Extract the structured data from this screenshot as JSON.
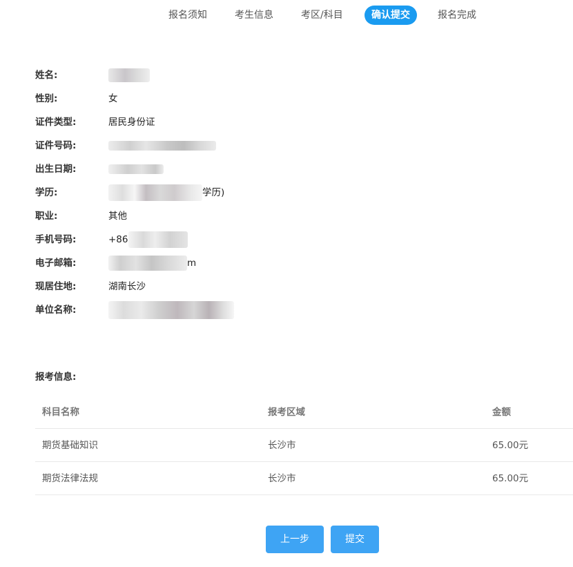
{
  "steps": [
    {
      "label": "报名须知",
      "active": false
    },
    {
      "label": "考生信息",
      "active": false
    },
    {
      "label": "考区/科目",
      "active": false
    },
    {
      "label": "确认提交",
      "active": true
    },
    {
      "label": "报名完成",
      "active": false
    }
  ],
  "info": {
    "name_label": "姓名:",
    "name_value": "",
    "gender_label": "性别:",
    "gender_value": "女",
    "id_type_label": "证件类型:",
    "id_type_value": "居民身份证",
    "id_number_label": "证件号码:",
    "id_number_value": "",
    "birth_label": "出生日期:",
    "birth_value": "",
    "education_label": "学历:",
    "education_value": "学历)",
    "occupation_label": "职业:",
    "occupation_value": "其他",
    "phone_label": "手机号码:",
    "phone_value": "+86",
    "email_label": "电子邮箱:",
    "email_value": "m",
    "residence_label": "现居住地:",
    "residence_value": "湖南长沙",
    "company_label": "单位名称:",
    "company_value": ""
  },
  "exam_section_title": "报考信息:",
  "exam_table": {
    "headers": [
      "科目名称",
      "报考区域",
      "金额"
    ],
    "rows": [
      [
        "期货基础知识",
        "长沙市",
        "65.00元"
      ],
      [
        "期货法律法规",
        "长沙市",
        "65.00元"
      ]
    ]
  },
  "buttons": {
    "prev_label": "上一步",
    "submit_label": "提交"
  },
  "colors": {
    "accent": "#1a9bf0",
    "button": "#3ea4f4"
  }
}
